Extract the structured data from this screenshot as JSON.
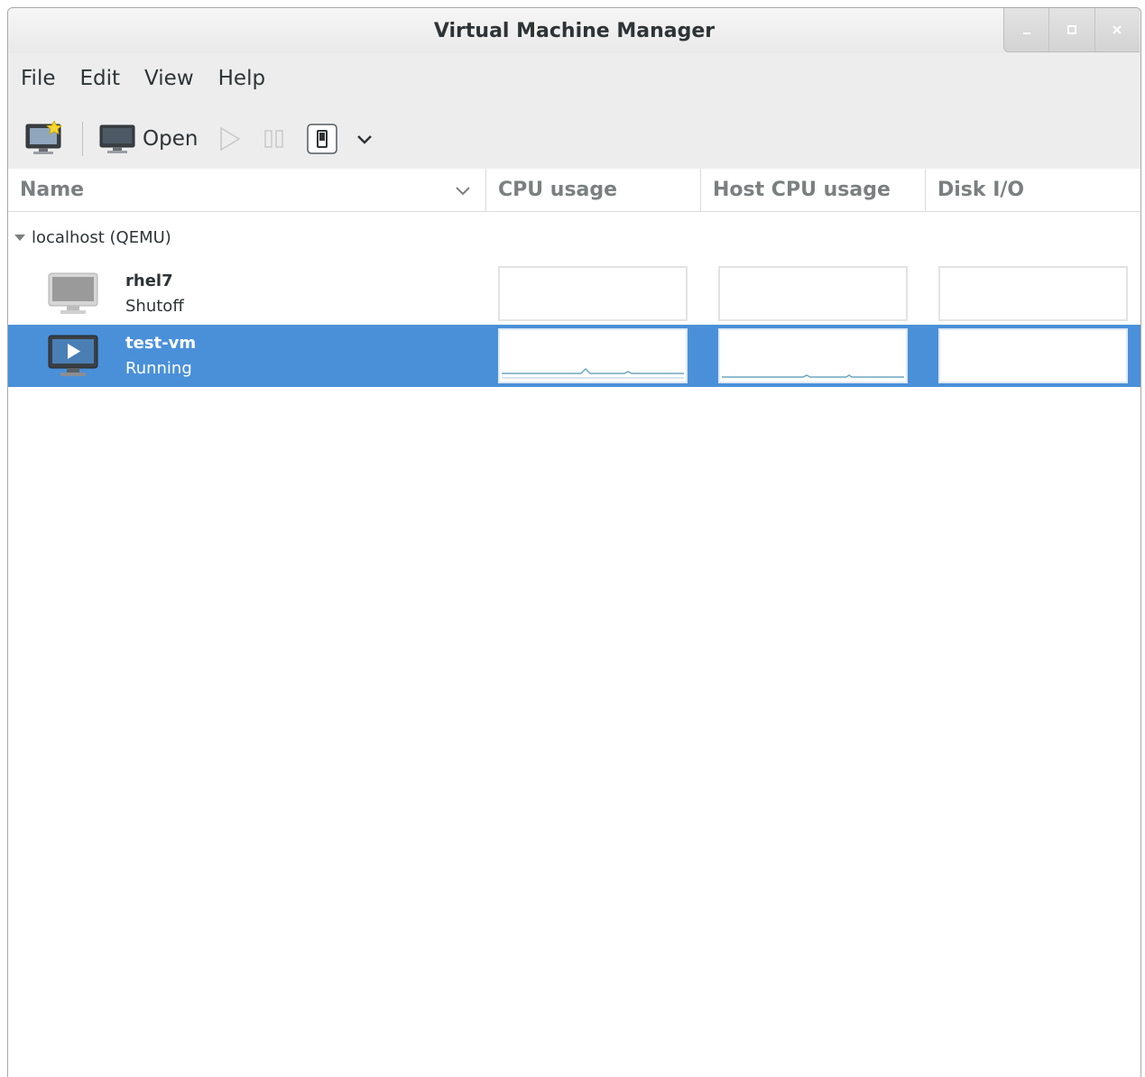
{
  "window": {
    "title": "Virtual Machine Manager"
  },
  "menubar": {
    "items": [
      "File",
      "Edit",
      "View",
      "Help"
    ]
  },
  "toolbar": {
    "new_vm_icon": "new-vm-icon",
    "open_label": "Open",
    "run_icon": "play-icon",
    "pause_icon": "pause-icon",
    "shutdown_icon": "shutdown-icon",
    "menu_icon": "chevron-down-icon"
  },
  "columns": {
    "name": "Name",
    "cpu": "CPU usage",
    "host_cpu": "Host CPU usage",
    "disk": "Disk I/O"
  },
  "connections": [
    {
      "label": "localhost (QEMU)",
      "vms": [
        {
          "name": "rhel7",
          "status": "Shutoff",
          "selected": false
        },
        {
          "name": "test-vm",
          "status": "Running",
          "selected": true
        }
      ]
    }
  ],
  "colors": {
    "selection": "#4a90d9",
    "graph_line": "#6ea7bd"
  }
}
